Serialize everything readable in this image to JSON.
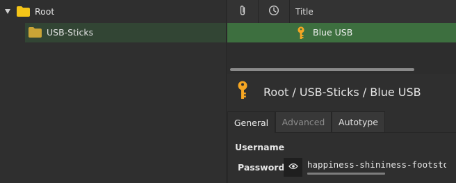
{
  "tree": {
    "root_label": "Root",
    "child_label": "USB-Sticks"
  },
  "table": {
    "columns": {
      "title": "Title"
    },
    "rows": [
      {
        "title": "Blue USB"
      }
    ]
  },
  "details": {
    "path": "Root / USB-Sticks / Blue USB",
    "tabs": [
      {
        "label": "General"
      },
      {
        "label": "Advanced"
      },
      {
        "label": "Autotype"
      }
    ],
    "fields": {
      "username_label": "Username",
      "password_label": "Password",
      "password_value": "happiness-shininess-footstool"
    }
  },
  "colors": {
    "selected_row": "#3d6f3f",
    "tree_selected": "#324534",
    "folder": "#f5c518",
    "key": "#f5a623"
  },
  "icons": [
    "folder-icon",
    "paperclip-icon",
    "clock-icon",
    "key-icon",
    "eye-icon"
  ]
}
